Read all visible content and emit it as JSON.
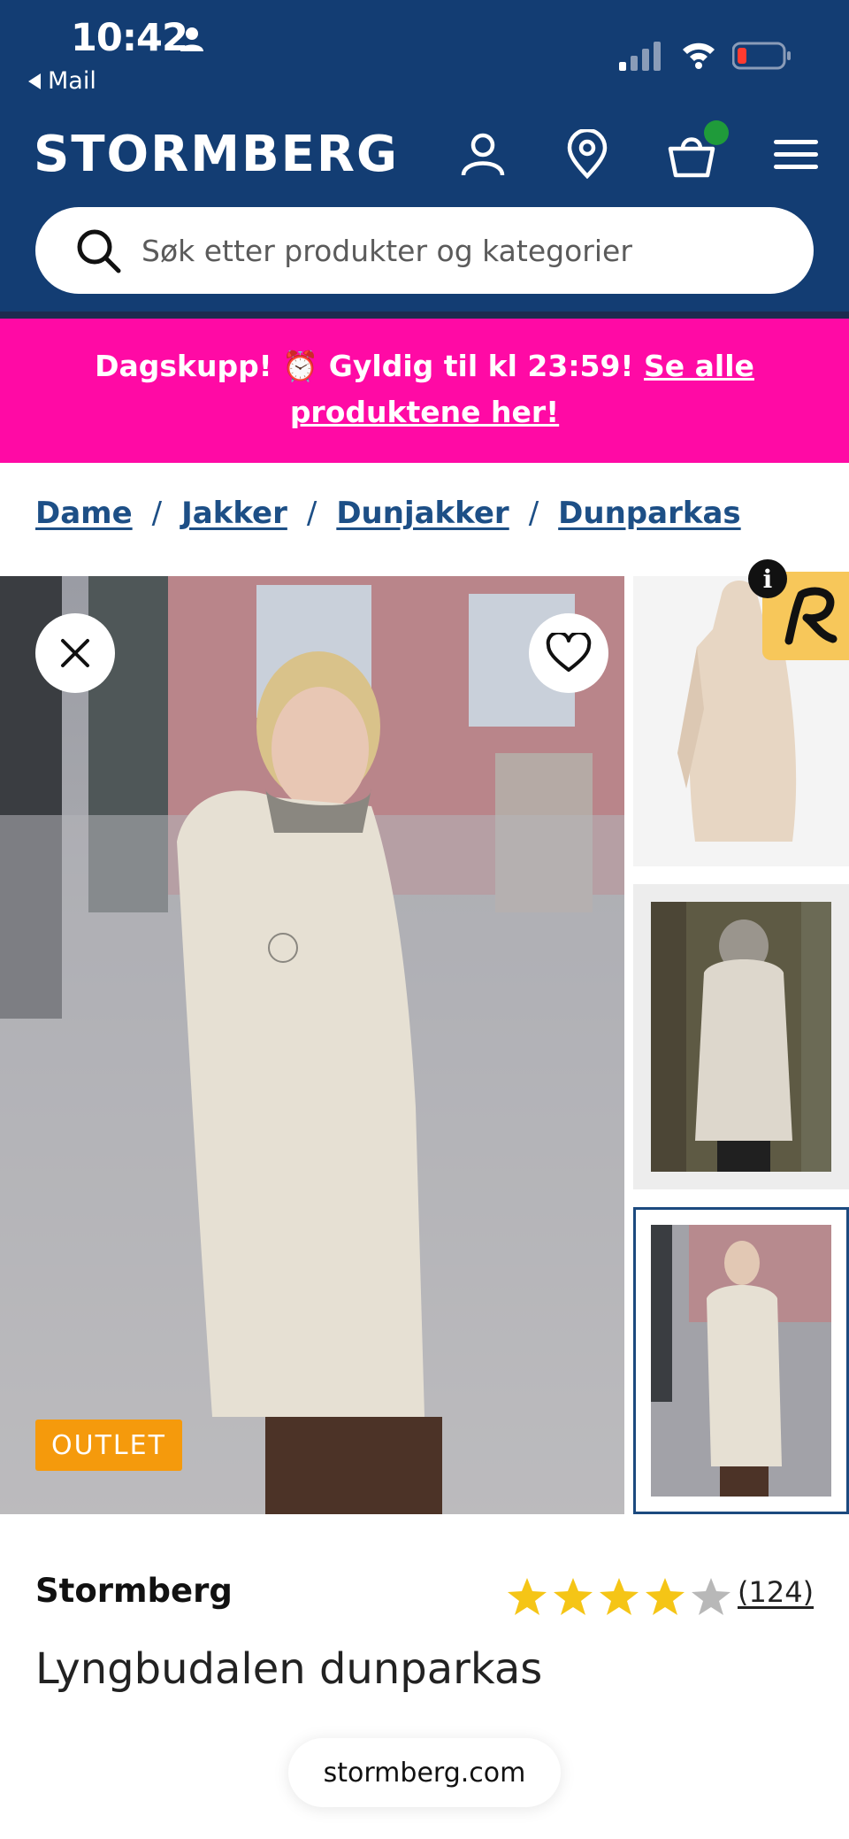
{
  "status_bar": {
    "time": "10:42",
    "back_label": "Mail"
  },
  "header": {
    "logo": "STORMBERG",
    "search_placeholder": "Søk etter produkter og kategorier",
    "colors": {
      "background": "#133d73",
      "cart_dot": "#1f9b3a"
    }
  },
  "promo": {
    "text_main": "Dagskupp! ⏰ Gyldig til kl 23:59! ",
    "link_text": "Se alle produktene her!",
    "color": "#ff0aa5"
  },
  "breadcrumb": {
    "items": [
      "Dame",
      "Jakker",
      "Dunjakker",
      "Dunparkas"
    ],
    "separator": "/"
  },
  "gallery": {
    "badge": "OUTLET",
    "badge_color": "#f59a0c",
    "info_badge": "i",
    "thumbnails": [
      "product-front-thumbnail",
      "back-view-thumbnail",
      "model-side-thumbnail"
    ],
    "selected_thumbnail": 3
  },
  "product": {
    "brand": "Stormberg",
    "name": "Lyngbudalen dunparkas",
    "rating_count": "(124)",
    "rating": 4,
    "rating_max": 5
  },
  "browser": {
    "url": "stormberg.com"
  }
}
